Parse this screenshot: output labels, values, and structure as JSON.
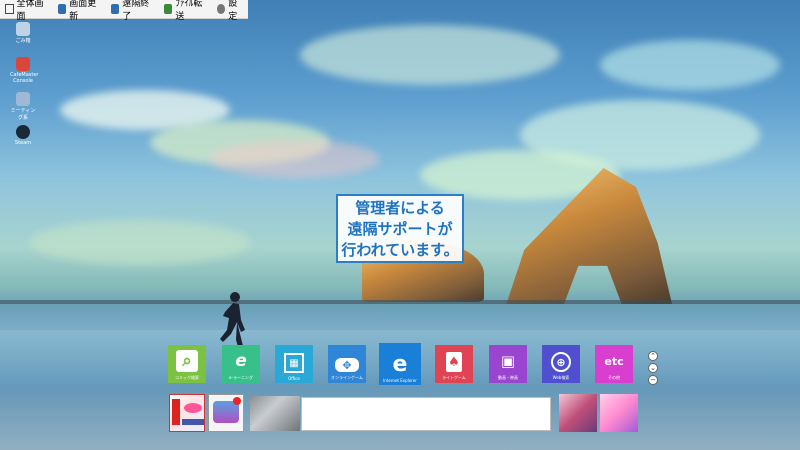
{
  "toolbar": {
    "items": [
      {
        "label": "全体画面",
        "icon": "fullscreen-icon",
        "color": "#444444"
      },
      {
        "label": "画面更新",
        "icon": "refresh-screen-icon",
        "color": "#2f6fb1"
      },
      {
        "label": "遠隔終了",
        "icon": "remote-end-icon",
        "color": "#2f6fb1"
      },
      {
        "label": "ﾌｧｲﾙ転送",
        "icon": "file-transfer-icon",
        "color": "#3a8a3a"
      },
      {
        "label": "設定",
        "icon": "settings-icon",
        "color": "#666666"
      }
    ]
  },
  "desktop_icons": [
    {
      "label": "ごみ箱",
      "icon": "recycle-bin-icon",
      "color": "#bfd2e6"
    },
    {
      "label": "CafeMaster Console",
      "icon": "cafemaster-icon",
      "color": "#d9473b"
    },
    {
      "label": "ミーティング系",
      "icon": "meeting-icon",
      "color": "#9fb8d8"
    },
    {
      "label": "Steam",
      "icon": "steam-icon",
      "color": "#1b2838"
    }
  ],
  "message": {
    "lines": [
      "管理者による",
      "遠隔サポートが",
      "行われています。"
    ],
    "border_color": "#2a7fc6",
    "text_color": "#1f74c2"
  },
  "tiles": [
    {
      "label": "コミック検索",
      "icon": "comic-search-icon",
      "color": "#7cc242",
      "glyph": "⌕"
    },
    {
      "label": "e-ラーニング",
      "icon": "e-learning-icon",
      "color": "#37c08a",
      "glyph": "e"
    },
    {
      "label": "Office",
      "icon": "office-icon",
      "color": "#2aa8d8",
      "glyph": "▦"
    },
    {
      "label": "オンラインゲーム",
      "icon": "gamepad-icon",
      "color": "#2f86d6",
      "glyph": "✥"
    },
    {
      "label": "Internet Explorer",
      "icon": "internet-explorer-icon",
      "color": "#1a7fd6",
      "glyph": "e"
    },
    {
      "label": "ライトゲーム",
      "icon": "card-game-icon",
      "color": "#e04454",
      "glyph": "♠"
    },
    {
      "label": "動画・映画",
      "icon": "film-icon",
      "color": "#9a45cf",
      "glyph": "▣"
    },
    {
      "label": "Web検索",
      "icon": "web-search-icon",
      "color": "#4f4fd0",
      "glyph": "⊕"
    },
    {
      "label": "その他",
      "icon": "etc-icon",
      "color": "#d83fcf",
      "glyph": "etc"
    }
  ],
  "side_buttons": [
    {
      "icon": "chevron-up-icon",
      "glyph": "⌃"
    },
    {
      "icon": "chevron-down-icon",
      "glyph": "⌄"
    },
    {
      "icon": "minus-icon",
      "glyph": "−"
    }
  ]
}
